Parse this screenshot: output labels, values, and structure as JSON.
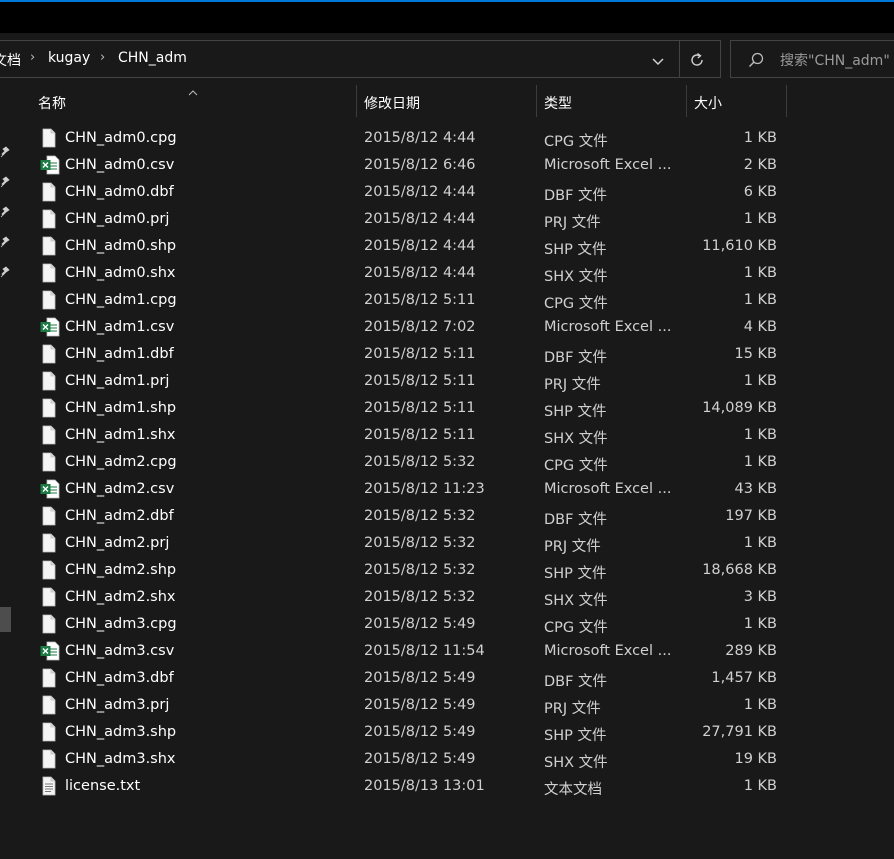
{
  "colors": {
    "accent": "#0078d7",
    "background": "#191919",
    "excel_green": "#1d7a45"
  },
  "address": {
    "crumbs": [
      "文档",
      "kugay",
      "CHN_adm"
    ],
    "dropdown_icon": "chevron-down-icon",
    "refresh_icon": "refresh-icon"
  },
  "search": {
    "placeholder": "搜索\"CHN_adm\"",
    "icon": "search-icon"
  },
  "columns": {
    "name": "名称",
    "date": "修改日期",
    "type": "类型",
    "size": "大小"
  },
  "files": [
    {
      "name": "CHN_adm0.cpg",
      "date": "2015/8/12 4:44",
      "type": "CPG 文件",
      "size": "1 KB",
      "icon": "file-icon"
    },
    {
      "name": "CHN_adm0.csv",
      "date": "2015/8/12 6:46",
      "type": "Microsoft Excel ...",
      "size": "2 KB",
      "icon": "excel-icon"
    },
    {
      "name": "CHN_adm0.dbf",
      "date": "2015/8/12 4:44",
      "type": "DBF 文件",
      "size": "6 KB",
      "icon": "file-icon"
    },
    {
      "name": "CHN_adm0.prj",
      "date": "2015/8/12 4:44",
      "type": "PRJ 文件",
      "size": "1 KB",
      "icon": "file-icon"
    },
    {
      "name": "CHN_adm0.shp",
      "date": "2015/8/12 4:44",
      "type": "SHP 文件",
      "size": "11,610 KB",
      "icon": "file-icon"
    },
    {
      "name": "CHN_adm0.shx",
      "date": "2015/8/12 4:44",
      "type": "SHX 文件",
      "size": "1 KB",
      "icon": "file-icon"
    },
    {
      "name": "CHN_adm1.cpg",
      "date": "2015/8/12 5:11",
      "type": "CPG 文件",
      "size": "1 KB",
      "icon": "file-icon"
    },
    {
      "name": "CHN_adm1.csv",
      "date": "2015/8/12 7:02",
      "type": "Microsoft Excel ...",
      "size": "4 KB",
      "icon": "excel-icon"
    },
    {
      "name": "CHN_adm1.dbf",
      "date": "2015/8/12 5:11",
      "type": "DBF 文件",
      "size": "15 KB",
      "icon": "file-icon"
    },
    {
      "name": "CHN_adm1.prj",
      "date": "2015/8/12 5:11",
      "type": "PRJ 文件",
      "size": "1 KB",
      "icon": "file-icon"
    },
    {
      "name": "CHN_adm1.shp",
      "date": "2015/8/12 5:11",
      "type": "SHP 文件",
      "size": "14,089 KB",
      "icon": "file-icon"
    },
    {
      "name": "CHN_adm1.shx",
      "date": "2015/8/12 5:11",
      "type": "SHX 文件",
      "size": "1 KB",
      "icon": "file-icon"
    },
    {
      "name": "CHN_adm2.cpg",
      "date": "2015/8/12 5:32",
      "type": "CPG 文件",
      "size": "1 KB",
      "icon": "file-icon"
    },
    {
      "name": "CHN_adm2.csv",
      "date": "2015/8/12 11:23",
      "type": "Microsoft Excel ...",
      "size": "43 KB",
      "icon": "excel-icon"
    },
    {
      "name": "CHN_adm2.dbf",
      "date": "2015/8/12 5:32",
      "type": "DBF 文件",
      "size": "197 KB",
      "icon": "file-icon"
    },
    {
      "name": "CHN_adm2.prj",
      "date": "2015/8/12 5:32",
      "type": "PRJ 文件",
      "size": "1 KB",
      "icon": "file-icon"
    },
    {
      "name": "CHN_adm2.shp",
      "date": "2015/8/12 5:32",
      "type": "SHP 文件",
      "size": "18,668 KB",
      "icon": "file-icon"
    },
    {
      "name": "CHN_adm2.shx",
      "date": "2015/8/12 5:32",
      "type": "SHX 文件",
      "size": "3 KB",
      "icon": "file-icon"
    },
    {
      "name": "CHN_adm3.cpg",
      "date": "2015/8/12 5:49",
      "type": "CPG 文件",
      "size": "1 KB",
      "icon": "file-icon"
    },
    {
      "name": "CHN_adm3.csv",
      "date": "2015/8/12 11:54",
      "type": "Microsoft Excel ...",
      "size": "289 KB",
      "icon": "excel-icon"
    },
    {
      "name": "CHN_adm3.dbf",
      "date": "2015/8/12 5:49",
      "type": "DBF 文件",
      "size": "1,457 KB",
      "icon": "file-icon"
    },
    {
      "name": "CHN_adm3.prj",
      "date": "2015/8/12 5:49",
      "type": "PRJ 文件",
      "size": "1 KB",
      "icon": "file-icon"
    },
    {
      "name": "CHN_adm3.shp",
      "date": "2015/8/12 5:49",
      "type": "SHP 文件",
      "size": "27,791 KB",
      "icon": "file-icon"
    },
    {
      "name": "CHN_adm3.shx",
      "date": "2015/8/12 5:49",
      "type": "SHX 文件",
      "size": "19 KB",
      "icon": "file-icon"
    },
    {
      "name": "license.txt",
      "date": "2015/8/13 13:01",
      "type": "文本文档",
      "size": "1 KB",
      "icon": "text-file-icon"
    }
  ]
}
